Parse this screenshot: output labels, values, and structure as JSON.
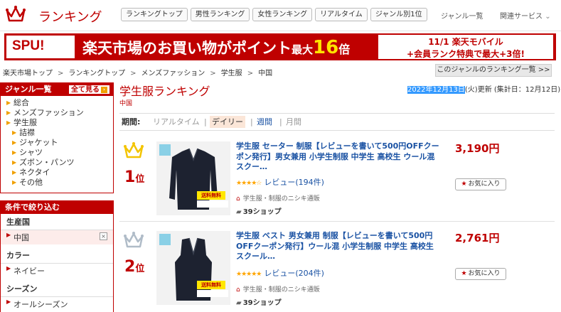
{
  "header": {
    "logo_text": "ランキング",
    "nav": [
      "ランキングトップ",
      "男性ランキング",
      "女性ランキング",
      "リアルタイム",
      "ジャンル別1位"
    ],
    "genre_list": "ジャンル一覧",
    "related_services": "関連サービス",
    "brand_color": "#bf0000"
  },
  "banner": {
    "spu": "SPU!",
    "main_a": "楽天市場のお買い物がポイント",
    "main_b": "最大",
    "main_big": "16",
    "main_c": "倍",
    "right_1": "11/1 楽天モバイル",
    "right_2": "+会員ランク特典で最大+3倍!"
  },
  "breadcrumb": [
    "楽天市場トップ",
    "ランキングトップ",
    "メンズファッション",
    "学生服",
    "中国"
  ],
  "genre_ranking_link": "このジャンルのランキング一覧 >>",
  "sidebar": {
    "genre_header": "ジャンル一覧",
    "see_all": "全て見る",
    "items": [
      {
        "label": "総合",
        "sub": false
      },
      {
        "label": "メンズファッション",
        "sub": false
      },
      {
        "label": "学生服",
        "sub": false
      },
      {
        "label": "詰襟",
        "sub": true
      },
      {
        "label": "ジャケット",
        "sub": true
      },
      {
        "label": "シャツ",
        "sub": true
      },
      {
        "label": "ズボン・パンツ",
        "sub": true
      },
      {
        "label": "ネクタイ",
        "sub": true
      },
      {
        "label": "その他",
        "sub": true
      }
    ],
    "filter_header": "条件で絞り込む",
    "filters": [
      {
        "title": "生産国",
        "value": "中国",
        "selected": true,
        "remove": "×"
      },
      {
        "title": "カラー",
        "value": "ネイビー",
        "selected": false
      },
      {
        "title": "シーズン",
        "value": "オールシーズン",
        "selected": false
      }
    ]
  },
  "main": {
    "title": "学生服ランキング",
    "genre": "中国",
    "update_date": "2022年12月13日",
    "update_suffix": "(火)更新 (集計日：12月12日)",
    "period_label": "期間:",
    "periods": [
      "リアルタイム",
      "デイリー",
      "週間",
      "月間"
    ],
    "active_period": "デイリー"
  },
  "items": [
    {
      "rank": "1",
      "rank_unit": "位",
      "crown_color": "#f3c400",
      "title": "学生服 セーター 制服【レビューを書いて500円OFFクーポン発行】男女兼用 小学生制服 中学生 高校生 ウール混 スクー…",
      "stars": "★★★★☆",
      "review": "レビュー(194件)",
      "shop": "学生服・制服のニシキ通販",
      "shop_badge": "39ショップ",
      "price": "3,190円",
      "fav": "お気に入り",
      "shipping": "送料無料"
    },
    {
      "rank": "2",
      "rank_unit": "位",
      "crown_color": "#b0bcc8",
      "title": "学生服 ベスト 男女兼用 制服【レビューを書いて500円OFFクーポン発行】ウール混 小学生制服 中学生 高校生 スクール…",
      "stars": "★★★★★",
      "review": "レビュー(204件)",
      "shop": "学生服・制服のニシキ通販",
      "shop_badge": "39ショップ",
      "price": "2,761円",
      "fav": "お気に入り",
      "shipping": "送料無料"
    }
  ]
}
